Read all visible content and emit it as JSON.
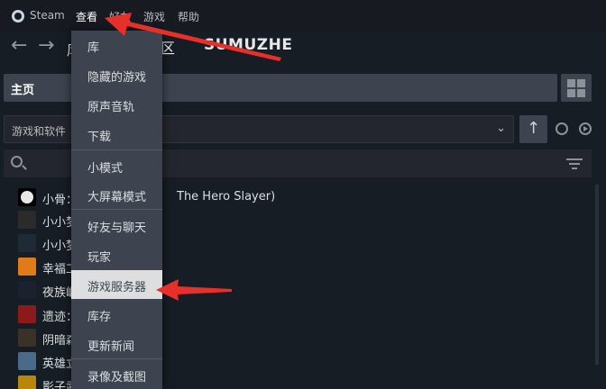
{
  "menubar": {
    "steam": "Steam",
    "view": "查看",
    "friends": "好友",
    "games": "游戏",
    "help": "帮助"
  },
  "nav": {
    "back_icon": "arrow-left-icon",
    "forward_icon": "arrow-right-icon",
    "prefix": "库",
    "dash": "区",
    "title": "SUMUZHE"
  },
  "home": {
    "label": "主页"
  },
  "filter": {
    "label": "游戏和软件",
    "chevron": "⌄"
  },
  "sort": {
    "arrow": "↑"
  },
  "games": [
    {
      "name": "小骨：",
      "suffix": "The Hero Slayer)",
      "icon_color": "#e8e8e8"
    },
    {
      "name": "小小梦",
      "icon_color": "#2b2b2b"
    },
    {
      "name": "小小梦",
      "icon_color": "#1e2a36"
    },
    {
      "name": "幸福工",
      "icon_color": "#e07b1a"
    },
    {
      "name": "夜族崛",
      "icon_color": "#1c2130"
    },
    {
      "name": "遗迹：",
      "icon_color": "#8b1a1a"
    },
    {
      "name": "阴暗森",
      "icon_color": "#3a3226"
    },
    {
      "name": "英雄立",
      "icon_color": "#4a6a8a"
    },
    {
      "name": "影子武",
      "icon_color": "#b8860b"
    }
  ],
  "dropdown": {
    "items": [
      "库",
      "隐藏的游戏",
      "原声音轨",
      "下载",
      "小模式",
      "大屏幕模式",
      "好友与聊天",
      "玩家",
      "游戏服务器",
      "库存",
      "更新新闻",
      "录像及截图"
    ],
    "highlighted": "游戏服务器"
  },
  "colors": {
    "background": "#171d25",
    "menu_bg": "#3d4450",
    "annotation_arrow": "#e8302a"
  }
}
